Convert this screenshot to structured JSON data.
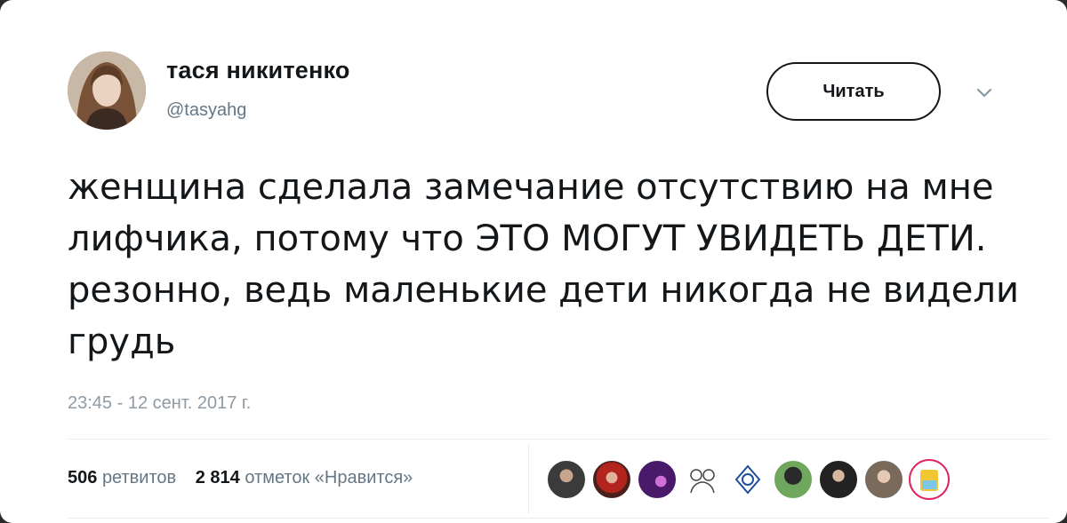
{
  "tweet": {
    "display_name": "тася никитенко",
    "handle": "@tasyahg",
    "follow_label": "Читать",
    "text": "женщина сделала замечание отсутствию на мне лифчика, потому что ЭТО МОГУТ УВИДЕТЬ ДЕТИ. резонно, ведь маленькие дети никогда не видели грудь",
    "timestamp": "23:45 - 12 сент. 2017 г.",
    "retweets_count": "506",
    "retweets_label": "ретвитов",
    "likes_count": "2 814",
    "likes_label": "отметок «Нравится»"
  },
  "liker_avatars": [
    {
      "icon": "user-avatar"
    },
    {
      "icon": "user-avatar"
    },
    {
      "icon": "user-avatar"
    },
    {
      "icon": "user-avatar"
    },
    {
      "icon": "user-avatar"
    },
    {
      "icon": "user-avatar"
    },
    {
      "icon": "user-avatar"
    },
    {
      "icon": "user-avatar"
    },
    {
      "icon": "user-avatar"
    }
  ],
  "colors": {
    "text_primary": "#14171a",
    "text_secondary": "#657786",
    "border": "#e6ecf0"
  }
}
